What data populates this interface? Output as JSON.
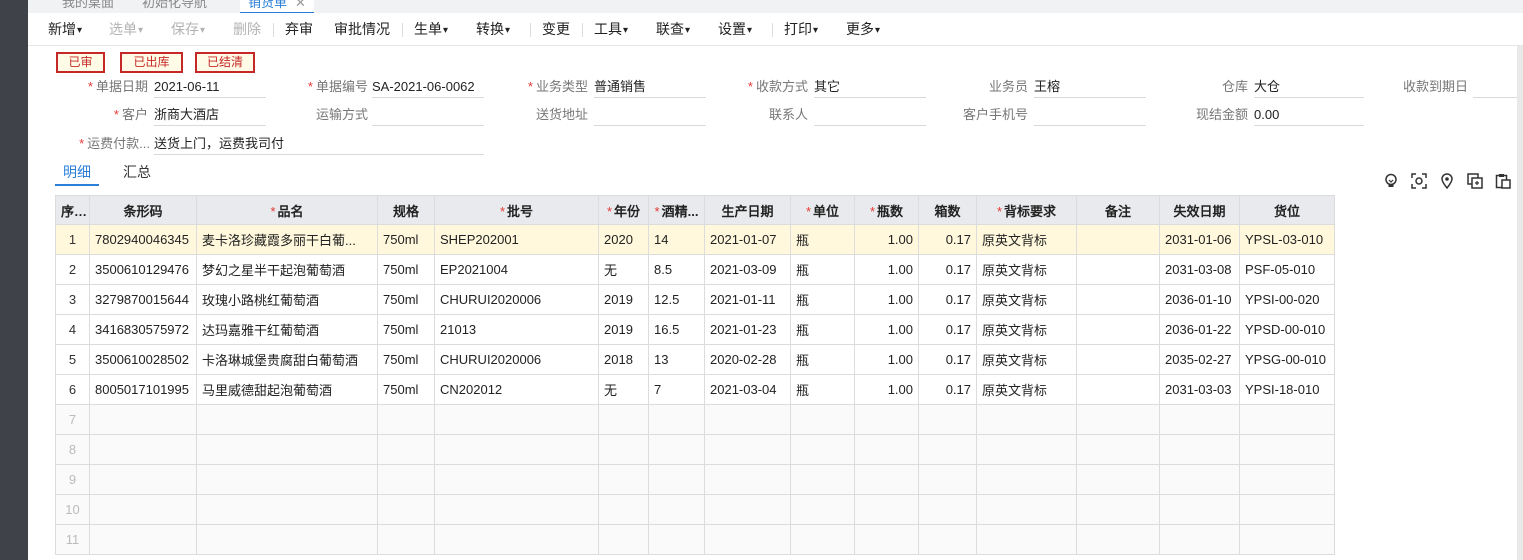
{
  "tabs": [
    {
      "label": "我的桌面"
    },
    {
      "label": "初始化导航"
    },
    {
      "label": "销货单",
      "close": "✕"
    }
  ],
  "toolbar": {
    "items": [
      {
        "label": "新增",
        "dropdown": true,
        "disabled": false
      },
      {
        "label": "选单",
        "dropdown": true,
        "disabled": true
      },
      {
        "label": "保存",
        "dropdown": true,
        "disabled": true
      },
      {
        "label": "删除",
        "dropdown": false,
        "disabled": true
      },
      {
        "label": "弃审",
        "dropdown": false,
        "disabled": false
      },
      {
        "label": "审批情况",
        "dropdown": false,
        "disabled": false
      },
      {
        "label": "生单",
        "dropdown": true,
        "disabled": false
      },
      {
        "label": "转换",
        "dropdown": true,
        "disabled": false
      },
      {
        "label": "变更",
        "dropdown": false,
        "disabled": false
      },
      {
        "label": "工具",
        "dropdown": true,
        "disabled": false
      },
      {
        "label": "联查",
        "dropdown": true,
        "disabled": false
      },
      {
        "label": "设置",
        "dropdown": true,
        "disabled": false
      },
      {
        "label": "打印",
        "dropdown": true,
        "disabled": false
      },
      {
        "label": "更多",
        "dropdown": true,
        "disabled": false
      }
    ]
  },
  "badges": [
    "已审",
    "已出库",
    "已结清"
  ],
  "form": {
    "doc_date": {
      "label": "单据日期",
      "required": true,
      "value": "2021-06-11"
    },
    "doc_no": {
      "label": "单据编号",
      "required": true,
      "value": "SA-2021-06-0062"
    },
    "biz_type": {
      "label": "业务类型",
      "required": true,
      "value": "普通销售"
    },
    "pay_method": {
      "label": "收款方式",
      "required": true,
      "value": "其它"
    },
    "salesman": {
      "label": "业务员",
      "required": false,
      "value": "王榕"
    },
    "warehouse": {
      "label": "仓库",
      "required": false,
      "value": "大仓"
    },
    "due_date": {
      "label": "收款到期日",
      "required": false,
      "value": ""
    },
    "customer": {
      "label": "客户",
      "required": true,
      "value": "浙商大酒店"
    },
    "transport": {
      "label": "运输方式",
      "required": false,
      "value": ""
    },
    "address": {
      "label": "送货地址",
      "required": false,
      "value": ""
    },
    "contact": {
      "label": "联系人",
      "required": false,
      "value": ""
    },
    "mobile": {
      "label": "客户手机号",
      "required": false,
      "value": ""
    },
    "cash_amount": {
      "label": "现结金额",
      "required": false,
      "value": "0.00"
    },
    "freight": {
      "label": "运费付款...",
      "required": true,
      "value": "送货上门，运费我司付"
    }
  },
  "subtabs": [
    {
      "label": "明细"
    },
    {
      "label": "汇总"
    }
  ],
  "header_icons": [
    "bulb-icon",
    "scan-icon",
    "location-icon",
    "copy-icon",
    "paste-icon"
  ],
  "grid": {
    "columns": [
      {
        "label": "序号",
        "required": false
      },
      {
        "label": "条形码",
        "required": false
      },
      {
        "label": "品名",
        "required": true
      },
      {
        "label": "规格",
        "required": false
      },
      {
        "label": "批号",
        "required": true
      },
      {
        "label": "年份",
        "required": true
      },
      {
        "label": "酒精...",
        "required": true
      },
      {
        "label": "生产日期",
        "required": false
      },
      {
        "label": "单位",
        "required": true
      },
      {
        "label": "瓶数",
        "required": true
      },
      {
        "label": "箱数",
        "required": false
      },
      {
        "label": "背标要求",
        "required": true
      },
      {
        "label": "备注",
        "required": false
      },
      {
        "label": "失效日期",
        "required": false
      },
      {
        "label": "货位",
        "required": false
      }
    ],
    "rows": [
      [
        "1",
        "7802940046345",
        "麦卡洛珍藏霞多丽干白葡...",
        "750ml",
        "SHEP202001",
        "2020",
        "14",
        "2021-01-07",
        "瓶",
        "1.00",
        "0.17",
        "原英文背标",
        "",
        "2031-01-06",
        "YPSL-03-010"
      ],
      [
        "2",
        "3500610129476",
        "梦幻之星半干起泡葡萄酒",
        "750ml",
        "EP2021004",
        "无",
        "8.5",
        "2021-03-09",
        "瓶",
        "1.00",
        "0.17",
        "原英文背标",
        "",
        "2031-03-08",
        "PSF-05-010"
      ],
      [
        "3",
        "3279870015644",
        "玫瑰小路桃红葡萄酒",
        "750ml",
        "CHURUI2020006",
        "2019",
        "12.5",
        "2021-01-11",
        "瓶",
        "1.00",
        "0.17",
        "原英文背标",
        "",
        "2036-01-10",
        "YPSI-00-020"
      ],
      [
        "4",
        "3416830575972",
        "达玛嘉雅干红葡萄酒",
        "750ml",
        "21013",
        "2019",
        "16.5",
        "2021-01-23",
        "瓶",
        "1.00",
        "0.17",
        "原英文背标",
        "",
        "2036-01-22",
        "YPSD-00-010"
      ],
      [
        "5",
        "3500610028502",
        "卡洛琳城堡贵腐甜白葡萄酒",
        "750ml",
        "CHURUI2020006",
        "2018",
        "13",
        "2020-02-28",
        "瓶",
        "1.00",
        "0.17",
        "原英文背标",
        "",
        "2035-02-27",
        "YPSG-00-010"
      ],
      [
        "6",
        "8005017101995",
        "马里威德甜起泡葡萄酒",
        "750ml",
        "CN202012",
        "无",
        "7",
        "2021-03-04",
        "瓶",
        "1.00",
        "0.17",
        "原英文背标",
        "",
        "2031-03-03",
        "YPSI-18-010"
      ]
    ],
    "empty_rows": [
      "7",
      "8",
      "9",
      "10",
      "11"
    ]
  },
  "colors": {
    "accent": "#2b7fd8",
    "required": "#e53935",
    "badge": "#c62828",
    "selected_row": "#fff8dc",
    "header_bg": "#e8eaed"
  }
}
